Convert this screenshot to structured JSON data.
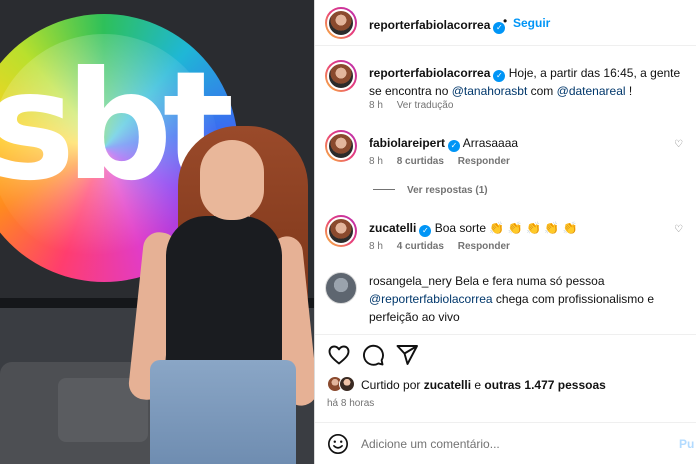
{
  "brand": {
    "logo_text": "sbt"
  },
  "header": {
    "username": "reporterfabiolacorrea",
    "separator": "•",
    "follow_label": "Seguir"
  },
  "caption": {
    "username": "reporterfabiolacorrea",
    "text_before": " Hoje, a partir das 16:45, a gente se encontra no ",
    "mention1": "@tanahorasbt",
    "text_middle": " com ",
    "mention2": "@datenareal",
    "text_after": " !",
    "time": "8 h",
    "translate_label": "Ver tradução"
  },
  "comments": [
    {
      "username": "fabiolareipert",
      "verified": true,
      "text": " Arrasaaaa",
      "time": "8 h",
      "likes": "8 curtidas",
      "reply_label": "Responder"
    },
    {
      "username": "zucatelli",
      "verified": true,
      "text": " Boa sorte 👏 👏 👏 👏 👏",
      "time": "8 h",
      "likes": "4 curtidas",
      "reply_label": "Responder"
    },
    {
      "username": "rosangela_nery",
      "verified": false,
      "text_before": " Bela e fera numa só pessoa ",
      "mention": "@reporterfabiolacorrea",
      "text_after": " chega com profissionalismo e perfeição ao vivo"
    }
  ],
  "view_replies_label": "Ver respostas (1)",
  "likes": {
    "prefix": "Curtido por ",
    "user": "zucatelli",
    "middle": " e ",
    "others": "outras 1.477 pessoas"
  },
  "time_ago": "há 8 horas",
  "add_comment": {
    "placeholder": "Adicione um comentário...",
    "post_label": "Pu"
  },
  "icons": {
    "verified": "verified-badge-icon",
    "like": "heart-icon",
    "comment": "comment-bubble-icon",
    "share": "paper-plane-icon",
    "emoji": "smiley-icon"
  },
  "colors": {
    "link_blue": "#0095f6",
    "mention_blue": "#00376b",
    "muted": "#737373",
    "border": "#dbdbdb"
  }
}
